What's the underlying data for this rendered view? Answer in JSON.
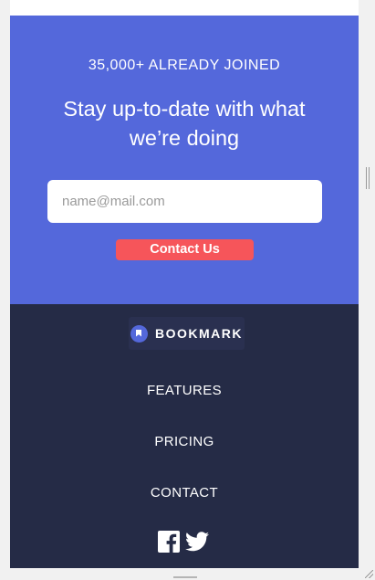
{
  "cta": {
    "joined_text": "35,000+ ALREADY JOINED",
    "headline": "Stay up-to-date with what we’re doing",
    "email_placeholder": "name@mail.com",
    "button_label": "Contact Us"
  },
  "footer": {
    "logo_text": "BOOKMARK",
    "nav": [
      {
        "label": "FEATURES"
      },
      {
        "label": "PRICING"
      },
      {
        "label": "CONTACT"
      }
    ],
    "social": [
      "facebook-icon",
      "twitter-icon"
    ]
  },
  "colors": {
    "cta_bg": "#5468db",
    "footer_bg": "#252b46",
    "button_bg": "#f6555a"
  }
}
